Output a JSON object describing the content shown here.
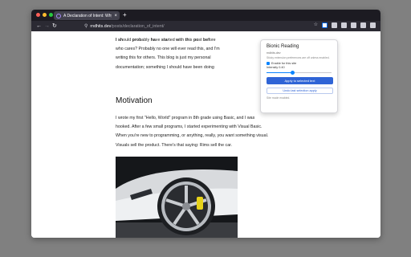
{
  "tab": {
    "title": "A Declaration of Intent: Why I ...",
    "close": "×",
    "new_tab": "+"
  },
  "nav": {
    "back": "←",
    "forward": "→",
    "reload": "↻",
    "url_host": "rndhits.dev",
    "url_path": "/posts/declaration_of_intent/"
  },
  "article": {
    "p1": [
      {
        "b": "I sh",
        "t": "ould "
      },
      {
        "b": "prob",
        "t": "ably "
      },
      {
        "b": "ha",
        "t": "ve "
      },
      {
        "b": "sta",
        "t": "rted "
      },
      {
        "b": "wi",
        "t": "th "
      },
      {
        "b": "th",
        "t": "is "
      },
      {
        "b": "po",
        "t": "st "
      },
      {
        "b": "bef",
        "t": "ore"
      }
    ],
    "p1_lines": [
      "who cares? Probably no one will ever read this, and I'm ",
      "writing this for others. This blog is just my personal ",
      "documentation; something I should have been doing"
    ],
    "heading": "Motivation",
    "p2_lines": [
      "I wrote my first \"Hello, World\" program in 8th grade using Basic, and I was",
      "hooked. After a few small programs, I started experimenting with Visual Basic.",
      "When you're new to programming, or anything, really, you want something visual.",
      "Visuals sell the product. There's that saying: Rims sell the car."
    ]
  },
  "popup": {
    "title": "Bionic Reading",
    "host": "rndhits.dev",
    "note": "Sticky extension preferences are off unless enabled.",
    "enable_label": "Enable for this site",
    "intensity_label": "Intensity 0.40",
    "intensity_value": 0.4,
    "apply_button": "Apply to selected text",
    "undo_button": "Undo last selection apply",
    "footer": "Site mode enabled."
  },
  "colors": {
    "accent": "#2f64d6",
    "toolbar": "#2b2a33",
    "tabstrip": "#1c1b22"
  }
}
